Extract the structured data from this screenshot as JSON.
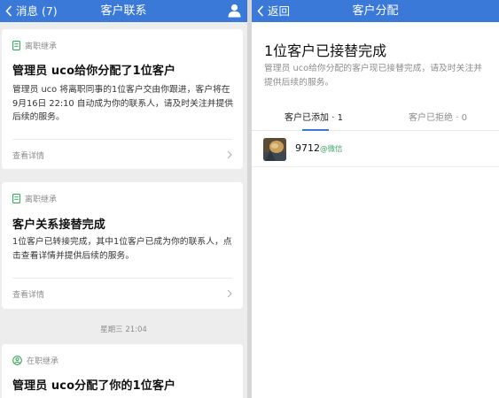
{
  "left": {
    "nav": {
      "back_label": "消息 (7)",
      "title": "客户联系"
    },
    "cards": [
      {
        "tag": "离职继承",
        "title": "管理员 uco给你分配了1位客户",
        "body": "管理员 uco 将离职同事的1位客户交由你跟进，客户将在 9月16日 22:10 自动成为你的联系人，请及时关注并提供后续的服务。",
        "detail": "查看详情"
      },
      {
        "tag": "离职继承",
        "title": "客户关系接替完成",
        "body": "1位客户已转接完成，其中1位客户已成为你的联系人，点击查看详情并提供后续的服务。",
        "detail": "查看详情"
      },
      {
        "tag": "在职继承",
        "title": "管理员 uco分配了你的1位客户"
      }
    ],
    "timestamp": "星期三 21:04"
  },
  "right": {
    "nav": {
      "back_label": "返回",
      "title": "客户分配"
    },
    "heading": "1位客户已接替完成",
    "description": "管理员 uco给你分配的客户现已接替完成，请及时关注并提供后续的服务。",
    "tabs": [
      {
        "label": "客户已添加 · 1",
        "active": true
      },
      {
        "label": "客户已拒绝 · 0",
        "active": false
      }
    ],
    "customers": [
      {
        "name": "9712",
        "source": "@微信"
      }
    ]
  },
  "colors": {
    "nav": "#3b79d8",
    "wechat_green": "#3ba55c",
    "tag_icon_green": "#3ba55c"
  }
}
